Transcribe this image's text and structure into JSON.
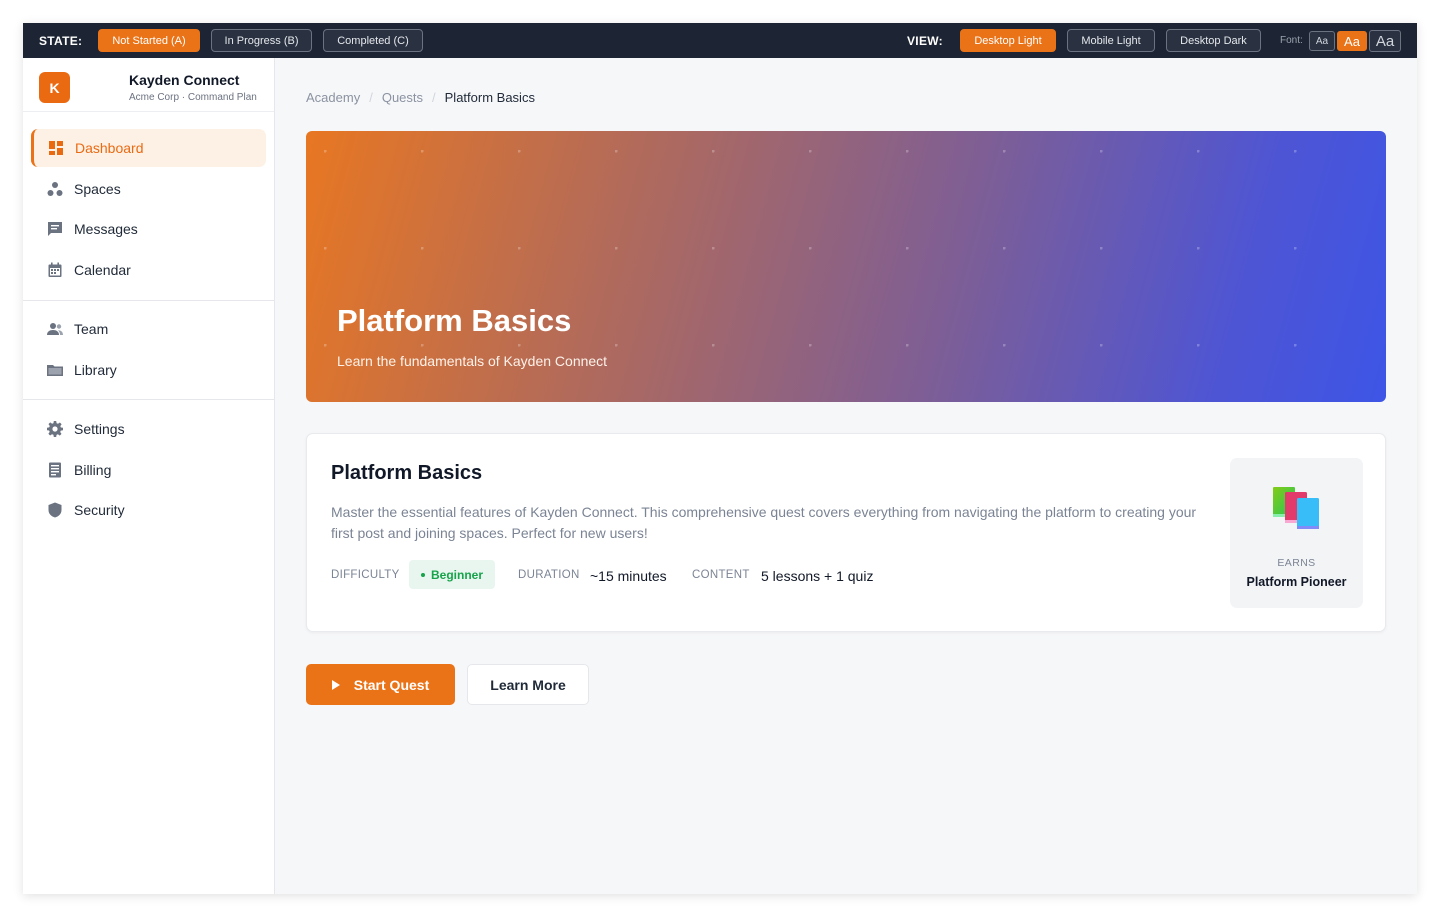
{
  "topbar": {
    "state_label": "STATE:",
    "states": [
      "Not Started (A)",
      "In Progress (B)",
      "Completed (C)"
    ],
    "view_label": "VIEW:",
    "views": [
      "Desktop Light",
      "Mobile Light",
      "Desktop Dark"
    ],
    "font_label": "Font:",
    "font_sizes": [
      "Aa",
      "Aa",
      "Aa"
    ]
  },
  "brand": {
    "initial": "K",
    "name": "Kayden Connect",
    "sub": "Acme Corp · Command Plan"
  },
  "sidebar": {
    "items": [
      {
        "label": "Dashboard",
        "icon": "dashboard-icon"
      },
      {
        "label": "Spaces",
        "icon": "spaces-icon"
      },
      {
        "label": "Messages",
        "icon": "message-icon"
      },
      {
        "label": "Calendar",
        "icon": "calendar-icon"
      },
      {
        "label": "Team",
        "icon": "team-icon"
      },
      {
        "label": "Library",
        "icon": "folder-icon"
      },
      {
        "label": "Settings",
        "icon": "gear-icon"
      },
      {
        "label": "Billing",
        "icon": "receipt-icon"
      },
      {
        "label": "Security",
        "icon": "shield-icon"
      }
    ]
  },
  "breadcrumb": [
    "Academy",
    "Quests",
    "Platform Basics"
  ],
  "hero": {
    "title": "Platform Basics",
    "subtitle": "Learn the fundamentals of Kayden Connect"
  },
  "quest": {
    "title": "Platform Basics",
    "description": "Master the essential features of Kayden Connect. This comprehensive quest covers everything from navigating the platform to creating your first post and joining spaces. Perfect for new users!",
    "difficulty_label": "DIFFICULTY",
    "difficulty": "Beginner",
    "duration_label": "DURATION",
    "duration": "~15 minutes",
    "content_label": "CONTENT",
    "content": "5 lessons + 1 quiz",
    "reward_label": "EARNS",
    "reward_name": "Platform Pioneer",
    "reward_icon": "books-icon"
  },
  "actions": {
    "start": "Start Quest",
    "learn": "Learn More"
  },
  "colors": {
    "accent": "#ea7317",
    "topbar": "#1d2433",
    "success": "#16a34a"
  }
}
